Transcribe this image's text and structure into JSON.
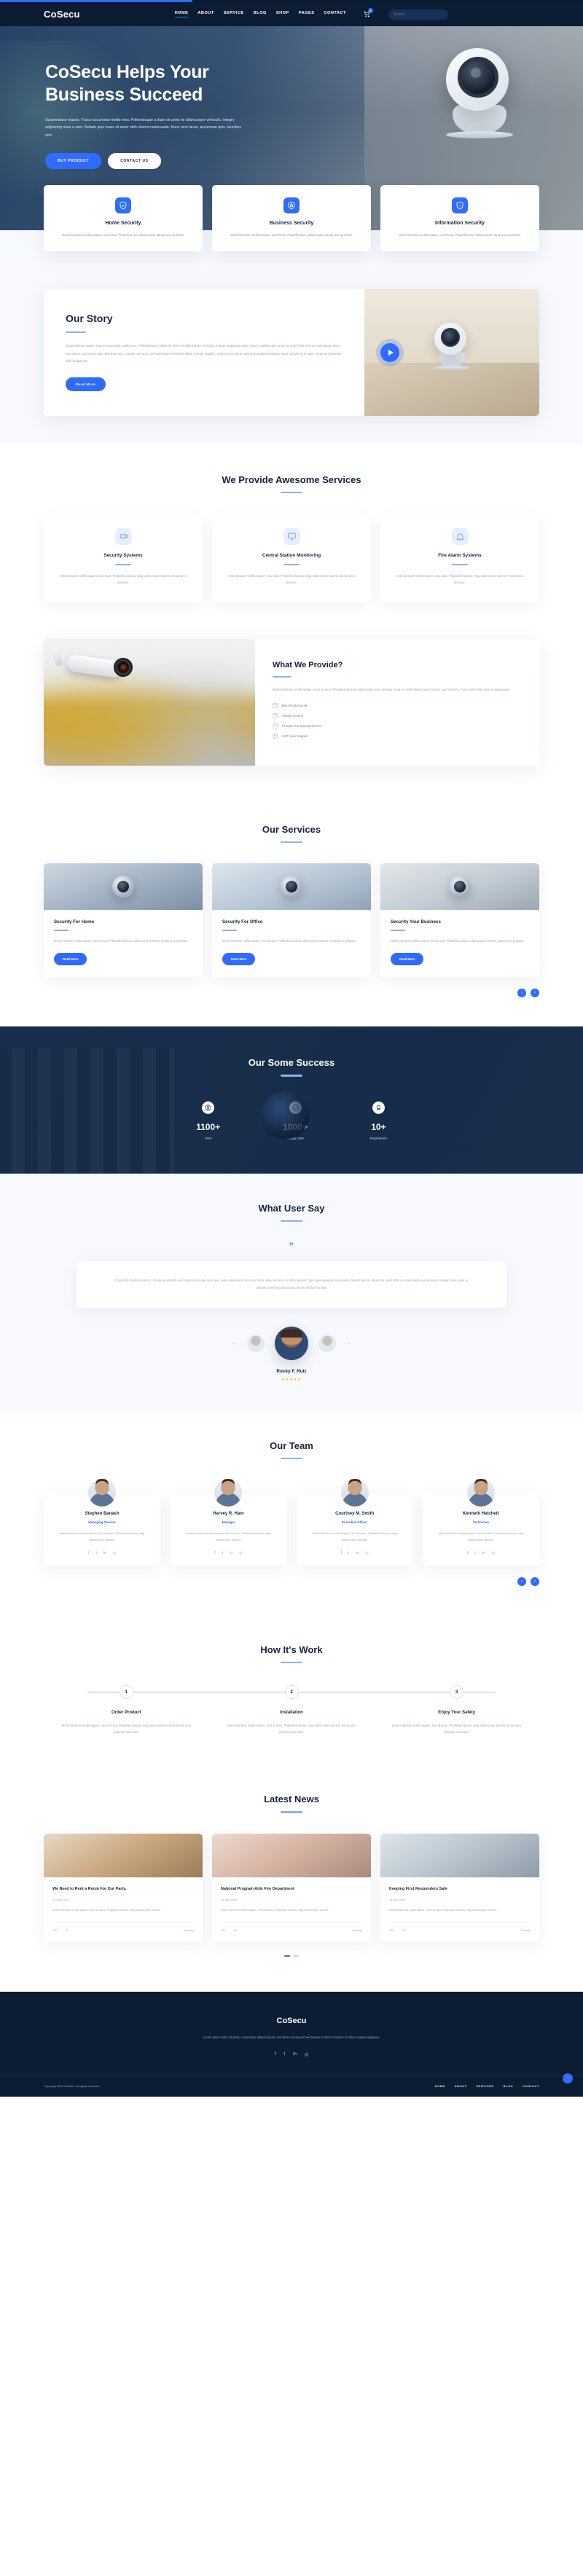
{
  "header": {
    "brand": "CoSecu",
    "nav": [
      {
        "label": "HOME",
        "active": true
      },
      {
        "label": "ABOUT",
        "active": false
      },
      {
        "label": "SERVICE",
        "active": false
      },
      {
        "label": "BLOG",
        "active": false
      },
      {
        "label": "SHOP",
        "active": false
      },
      {
        "label": "PAGES",
        "active": false
      },
      {
        "label": "CONTACT",
        "active": false
      }
    ],
    "cart_badge": "2",
    "search_placeholder": "Search",
    "search_value": ""
  },
  "hero": {
    "title_line1": "CoSecu Helps Your",
    "title_line2": "Business Succeed",
    "paragraph": "Suspendisse mauris. Fusce accumsan mollis eros. Pellentesque a diam sit amet mi ullamcorper vehicula. Integer adipiscing risus a sem. Nullam quis mass sit amet nibh viverra malesuada. Nunc sem lacus, accumsan quis, faucibus non.",
    "btn_primary": "BUY PRODUCT",
    "btn_secondary": "CONTACT US"
  },
  "features": [
    {
      "icon": "shield-check-icon",
      "title": "Home Security",
      "text": "Morbi interdum mollis sapien. Sed risus. Phasellus lacl, ullamcorper sandy arcu pulvinar."
    },
    {
      "icon": "shield-lock-icon",
      "title": "Business Security",
      "text": "Morbi interdum mollis sapien. Sed risus. Phasellus lacl, ullamcorper sandy arcu pulvinar."
    },
    {
      "icon": "shield-info-icon",
      "title": "Information Security",
      "text": "Morbi interdum mollis sapien. Sed risus. Phasellus lacl, ullamcorper sandy arcu pulvinar."
    }
  ],
  "story": {
    "title": "Our Story",
    "paragraph": "Suspendisse mauris. Fusce accumsan mollis eros. Pellentesque a diam sit amet mi ullamcorper vehicula. Integer adipiscing risus a sem. Nullam quis mass sit amet nibh viverra malesuada. Nunc sem lacus, accumsan quis, faucibus non, congue vel, arcu. Ut scelerisque hendrerit tellus. Integer sagittis. Vivamus a mauris eget arcu gravida tristique. Nunc iaculis mi in ante. Vivamus imperdiet nibh feugiat est.",
    "button": "Read More",
    "play_icon": "play-icon"
  },
  "services_section": {
    "title": "We Provide Awesome Services",
    "cards": [
      {
        "icon": "security-camera-icon",
        "title": "Security Systems",
        "text": "Orbi interdum mollis sapien. Sac risus. Phasellus lacinia, mag ullamcorper laoreet, lectus arcu pulvinar."
      },
      {
        "icon": "monitor-icon",
        "title": "Central Station Monitoring",
        "text": "Orbi interdum mollis sapien. Sac risus. Phasellus lacinia, mag ullamcorper laoreet, lectus arcu pulvinar."
      },
      {
        "icon": "alarm-icon",
        "title": "Fire Alarm Systems",
        "text": "Orbi interdum mollis sapien. Sac risus. Phasellus lacinia, mag ullamcorper laoreet, lectus arcu pulvinar."
      }
    ]
  },
  "provide": {
    "title": "What We Provide?",
    "paragraph": "Morbi interdum mollis sapien. Sed at risus. Phasellus lacinia, ullamcorper arcu pulvinar, mag eu mollis libero amet cursus, hac est arcu. Fusce nibh nibh viverra malesuada.",
    "checklist": [
      "Best Professional",
      "Always Honest",
      "Provide Our Special Service",
      "24/7 Hour Support"
    ],
    "image_alt": "surveillance-camera-photo"
  },
  "our_services": {
    "title": "Our Services",
    "cards": [
      {
        "title": "Security For Home",
        "text": "Morbi interdum mollis sapien. Sed a risus. Phasellus lacinia, ullamcorper laoreet, lectus arcu pulvinar.",
        "button": "Read More",
        "image_alt": "home-camera-photo"
      },
      {
        "title": "Security For Office",
        "text": "Morbi interdum mollis sapien. Sed a risus. Phasellus lacinia, ullamcorper laoreet, lectus arcu pulvinar.",
        "button": "Read More",
        "image_alt": "office-dome-camera-photo"
      },
      {
        "title": "Security Your Business",
        "text": "Morbi interdum mollis sapien. Sed a risus. Phasellus lacinia, ullamcorper laoreet, lectus arcu pulvinar.",
        "button": "Read More",
        "image_alt": "business-camera-photo"
      }
    ],
    "prev_arrow": "‹",
    "next_arrow": "›"
  },
  "success": {
    "title": "Our Some Success",
    "stats": [
      {
        "icon": "user-icon",
        "number": "1100+",
        "label": "User"
      },
      {
        "icon": "smile-icon",
        "number": "1000+",
        "label": "Happy User"
      },
      {
        "icon": "award-icon",
        "number": "10+",
        "label": "Experience"
      }
    ]
  },
  "testimonial": {
    "title": "What User Say",
    "quote_icon": "quote-icon",
    "quote": "Consectet mattimo auctor, ut lorem euismoth sed, suprendis node quisi quis, esse asperiorus for enim. Eicis vitae sed arcu in nibh pulvinar. Quis quis sapiente accumsan, blandit lacinia, pharet sit amet ultricies malesuada quis deserunt sapien vitae quisi ac mattimo enim sed amacusis, lieget eondum lacinia.",
    "name": "Rocky F. Ruiz",
    "stars": "★★★★★",
    "prev_arrow": "←",
    "next_arrow": "→"
  },
  "team": {
    "title": "Our Team",
    "members": [
      {
        "name": "Stephen Banach",
        "role": "Managing Director",
        "text": "Morbi interdum mollis sapien. Sed at risus. Phasellus lacinia, mag ullamcorper laoreet.",
        "socials": [
          "facebook-icon",
          "twitter-icon",
          "linkedin-icon",
          "instagram-icon"
        ]
      },
      {
        "name": "Harvey R. Ham",
        "role": "Manager",
        "text": "Morbi interdum mollis sapien. Sed at risus. Phasellus lacinia, mag ullamcorper laoreet.",
        "socials": [
          "facebook-icon",
          "twitter-icon",
          "linkedin-icon",
          "instagram-icon"
        ]
      },
      {
        "name": "Courtney M. Smith",
        "role": "Executive Officer",
        "text": "Morbi interdum mollis sapien. Sed at risus. Phasellus lacinia, mag ullamcorper laoreet.",
        "socials": [
          "facebook-icon",
          "twitter-icon",
          "linkedin-icon",
          "instagram-icon"
        ]
      },
      {
        "name": "Kenneth Hatchett",
        "role": "Technician",
        "text": "Morbi interdum mollis sapien. Sed at risus. Phasellus lacinia, mag ullamcorper laoreet.",
        "socials": [
          "facebook-icon",
          "twitter-icon",
          "linkedin-icon",
          "instagram-icon"
        ]
      }
    ],
    "prev_arrow": "‹",
    "next_arrow": "›"
  },
  "how_it_works": {
    "title": "How It's Work",
    "steps": [
      {
        "number": "1",
        "title": "Order Product",
        "text": "Morbi interdum mollis sapien. Sed at risus. Phasellus lacinia, mag ullamcorper laoreet, lectus arcu pulvinar mas class."
      },
      {
        "number": "2",
        "title": "Installation",
        "text": "Morbi interdum mollis sapien. Sed at risus. Phasellus lacinia, mag ullamcorper laoreet, lectus arcu pulvinar mas class."
      },
      {
        "number": "3",
        "title": "Enjoy Your Safety",
        "text": "Morbi interdum mollis sapien. Sed at risus. Phasellus lacinia, mag ullamcorper laoreet, lectus arcu pulvinar mas class."
      }
    ]
  },
  "news": {
    "title": "Latest News",
    "posts": [
      {
        "title": "We Need to Rent a Room For Our Party.",
        "date": "12 Aug 2019",
        "text": "Morbi interdum mollis sapien. Sed at risus. Phasellus lacinia, mag ullamcorper laoreet.",
        "views": "120",
        "comments": "10",
        "tag": "Security",
        "image_alt": "room-photo"
      },
      {
        "title": "National Program Aids Fire Department",
        "date": "14 Aug 2019",
        "text": "Morbi interdum mollis sapien. Sed at risus. Phasellus lacinia, mag ullamcorper laoreet.",
        "views": "120",
        "comments": "10",
        "tag": "Security",
        "image_alt": "fire-department-photo"
      },
      {
        "title": "Keeping First Responders Safe",
        "date": "16 Aug 2019",
        "text": "Morbi interdum mollis sapien. Sed at risus. Phasellus lacinia, mag ullamcorper laoreet.",
        "views": "120",
        "comments": "10",
        "tag": "Security",
        "image_alt": "responder-photo"
      }
    ]
  },
  "footer": {
    "brand": "CoSecu",
    "text": "Lorem ipsum dolor sit amet, consectetur adipiscing elit, sed diam nonumy eirmod tempor invidunt ut labore et dolore magna aliquyam.",
    "socials": [
      "facebook-icon",
      "twitter-icon",
      "linkedin-icon",
      "instagram-icon"
    ],
    "copyright_prefix": "Copyright 2019 CoSecu. All rights reserved",
    "links": [
      {
        "label": "HOME"
      },
      {
        "label": "ABOUT"
      },
      {
        "label": "SERVICES"
      },
      {
        "label": "BLOG"
      },
      {
        "label": "CONTACT"
      }
    ],
    "scroll_top_icon": "arrow-up-icon"
  },
  "colors": {
    "accent": "#2f6bff",
    "dark": "#0b1c33",
    "muted": "#9aa5ba",
    "soft_bg": "#f7f9fd"
  }
}
